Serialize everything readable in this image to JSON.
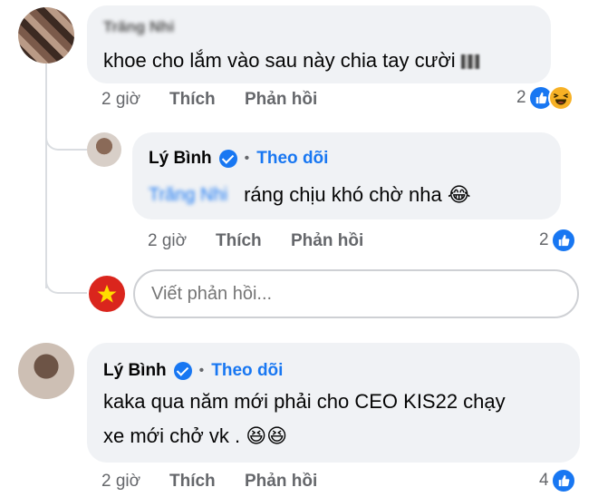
{
  "comment1": {
    "author": "Trăng Nhi",
    "text": "khoe cho lắm vào sau này chia tay cười",
    "time": "2 giờ",
    "like_label": "Thích",
    "reply_label": "Phản hồi",
    "reaction_count": "2",
    "reactions": [
      "like-icon",
      "haha-icon"
    ]
  },
  "reply1": {
    "author": "Lý Bình",
    "separator": "•",
    "follow_label": "Theo dõi",
    "mention": "Trăng Nhi",
    "text": "ráng chịu khó chờ nha 😂",
    "time": "2 giờ",
    "like_label": "Thích",
    "reply_label": "Phản hồi",
    "reaction_count": "2",
    "reactions": [
      "like-icon"
    ]
  },
  "reply_box": {
    "placeholder": "Viết phản hồi..."
  },
  "comment2": {
    "author": "Lý Bình",
    "separator": "•",
    "follow_label": "Theo dõi",
    "text_line1": "kaka qua năm mới phải cho CEO KIS22 chạy",
    "text_line2": "xe mới chở vk . 😆😆",
    "time": "2 giờ",
    "like_label": "Thích",
    "reply_label": "Phản hồi",
    "reaction_count": "4",
    "reactions": [
      "like-icon"
    ]
  },
  "colors": {
    "accent": "#1877f2",
    "bubble": "#f0f2f5",
    "meta_text": "#65676b",
    "flag_red": "#da251d",
    "flag_star": "#ffdd00"
  }
}
